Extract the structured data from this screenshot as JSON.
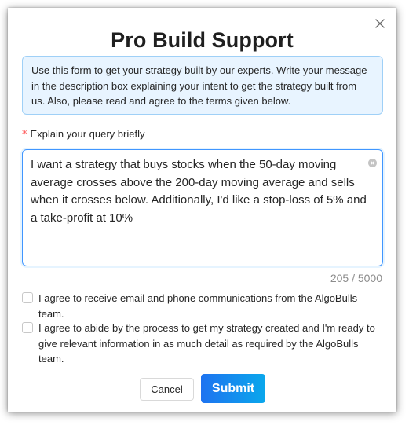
{
  "modal": {
    "title": "Pro Build Support",
    "close_icon": "close-icon"
  },
  "info": {
    "text": "Use this form to get your strategy built by our experts. Write your message in the description box explaining your intent to get the strategy built from us. Also, please read and agree to the terms given below."
  },
  "query": {
    "required_mark": "*",
    "label": "Explain your query briefly",
    "value": "I want a strategy that buys stocks when the 50-day moving average crosses above the 200-day moving average and sells when it crosses below. Additionally, I'd like a stop-loss of 5% and a take-profit at 10%",
    "counter": "205 / 5000",
    "clear_icon": "clear-icon"
  },
  "agreements": [
    {
      "label": "I agree to receive email and phone communications from the AlgoBulls team.",
      "checked": false
    },
    {
      "label": "I agree to abide by the process to get my strategy created and I'm ready to give relevant information in as much detail as required by the AlgoBulls team.",
      "checked": false
    }
  ],
  "footer": {
    "cancel_label": "Cancel",
    "submit_label": "Submit"
  },
  "colors": {
    "accent": "#1677ff",
    "info_bg": "#e8f4ff",
    "required": "#ff4d4f",
    "submit_gradient_start": "#1e73f0",
    "submit_gradient_end": "#0aa7ec"
  }
}
